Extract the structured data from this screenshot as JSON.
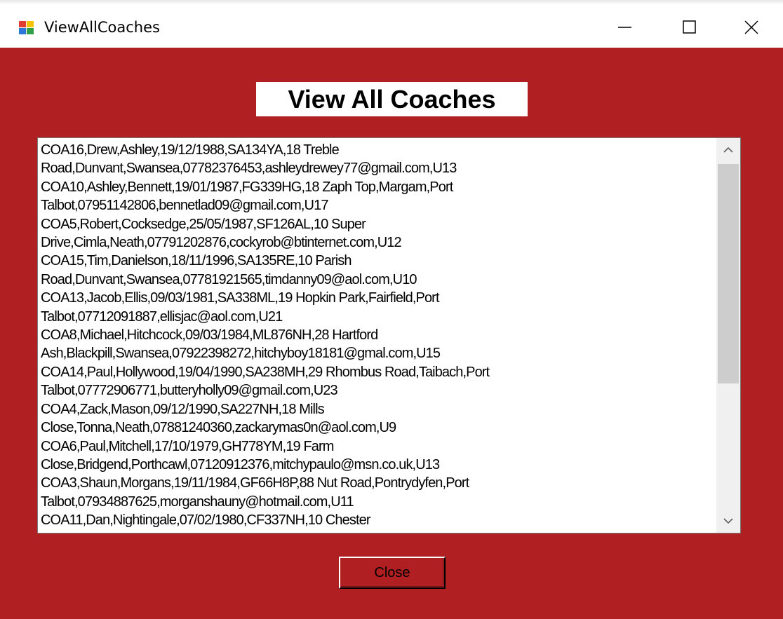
{
  "window": {
    "title": "ViewAllCoaches",
    "app_icon": "winforms-app-icon",
    "controls": {
      "minimize_icon": "minimize-icon",
      "maximize_icon": "maximize-icon",
      "close_icon": "close-icon"
    }
  },
  "colors": {
    "form_background": "#b01f21",
    "heading_background": "#ffffff",
    "scrollbar_thumb": "#cdcdcd"
  },
  "heading": "View All Coaches",
  "coach_list": {
    "lines": [
      "COA16,Drew,Ashley,19/12/1988,SA134YA,18 Treble",
      "Road,Dunvant,Swansea,07782376453,ashleydrewey77@gmail.com,U13",
      "COA10,Ashley,Bennett,19/01/1987,FG339HG,18 Zaph Top,Margam,Port",
      "Talbot,07951142806,bennetlad09@gmail.com,U17",
      "COA5,Robert,Cocksedge,25/05/1987,SF126AL,10 Super",
      "Drive,Cimla,Neath,07791202876,cockyrob@btinternet.com,U12",
      "COA15,Tim,Danielson,18/11/1996,SA135RE,10 Parish",
      "Road,Dunvant,Swansea,07781921565,timdanny09@aol.com,U10",
      "COA13,Jacob,Ellis,09/03/1981,SA338ML,19 Hopkin Park,Fairfield,Port",
      "Talbot,07712091887,ellisjac@aol.com,U21",
      "COA8,Michael,Hitchcock,09/03/1984,ML876NH,28 Hartford",
      "Ash,Blackpill,Swansea,07922398272,hitchyboy18181@gmal.com,U15",
      "COA14,Paul,Hollywood,19/04/1990,SA238MH,29 Rhombus Road,Taibach,Port",
      "Talbot,07772906771,butteryholly09@gmail.com,U23",
      "COA4,Zack,Mason,09/12/1990,SA227NH,18 Mills",
      "Close,Tonna,Neath,07881240360,zackarymas0n@aol.com,U9",
      "COA6,Paul,Mitchell,17/10/1979,GH778YM,19 Farm",
      "Close,Bridgend,Porthcawl,07120912376,mitchypaulo@msn.co.uk,U13",
      "COA3,Shaun,Morgans,19/11/1984,GF66H8P,88 Nut Road,Pontrydyfen,Port",
      "Talbot,07934887625,morganshauny@hotmail.com,U11",
      "COA11,Dan,Nightingale,07/02/1980,CF337NH,10 Chester"
    ],
    "scroll_up_icon": "scroll-up-icon",
    "scroll_down_icon": "scroll-down-icon"
  },
  "close_button": {
    "label": "Close"
  }
}
